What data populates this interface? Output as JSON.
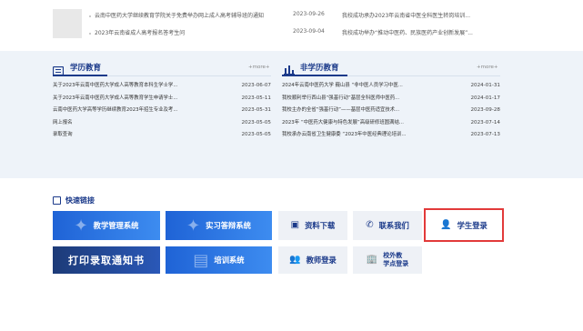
{
  "top_news": [
    {
      "title": "云南中医药大学继续教育学院关于免费举办网上成人高考辅导班的通知",
      "date": "2023-09-26",
      "right_title": "我校成功承办2023年云南省中医全科医生转岗培训..."
    },
    {
      "title": "2023年云南省成人高考报名答考生问",
      "date": "2023-09-04",
      "right_title": "我校成功举办“推动中医药、民族医药产业创新发展”..."
    }
  ],
  "academic": {
    "title": "学历教育",
    "more": "+more+",
    "items": [
      {
        "title": "关于2023年云南中医药大学成人高等教育本科生学士学...",
        "date": "2023-06-07"
      },
      {
        "title": "关于2023年云南中医药大学成人高等教育学生申请学士...",
        "date": "2023-05-11"
      },
      {
        "title": "云南中医药大学高等学历继续教育2023年招生专业及考...",
        "date": "2023-05-31"
      },
      {
        "title": "网上报名",
        "date": "2023-05-05"
      },
      {
        "title": "录取查询",
        "date": "2023-05-05"
      }
    ]
  },
  "non_academic": {
    "title": "非学历教育",
    "more": "+more+",
    "items": [
      {
        "title": "2024年云南中医药大学 巍山县 “非中医人员学习中医...",
        "date": "2024-01-31"
      },
      {
        "title": "我校顺利举行西山县“强基行动”基层全科医师中医药...",
        "date": "2024-01-17"
      },
      {
        "title": "我校主办的全省“强基行动”——基层中医药适宜技术...",
        "date": "2023-09-28"
      },
      {
        "title": "2023年 “中医药大健康与特色发展”高级研修班圆满结...",
        "date": "2023-07-14"
      },
      {
        "title": "我校承办云南省卫生健康委 “2023年中医经典理论培训...",
        "date": "2023-07-13"
      }
    ]
  },
  "quick_links": {
    "title": "快速链接",
    "buttons": [
      {
        "label": "教学管理系统"
      },
      {
        "label": "实习答辩系统"
      },
      {
        "label": "资料下载"
      },
      {
        "label": "联系我们"
      },
      {
        "label": "学生登录"
      },
      {
        "label": "打印录取通知书"
      },
      {
        "label": "培训系统"
      },
      {
        "label": "教师登录"
      },
      {
        "label": "校外教学点登录"
      }
    ],
    "outer_label_1": "校外教",
    "outer_label_2": "学点登录"
  },
  "colors": {
    "accent": "#1b3a8a",
    "highlight": "#e23a3a",
    "band": "#eef3f9"
  }
}
